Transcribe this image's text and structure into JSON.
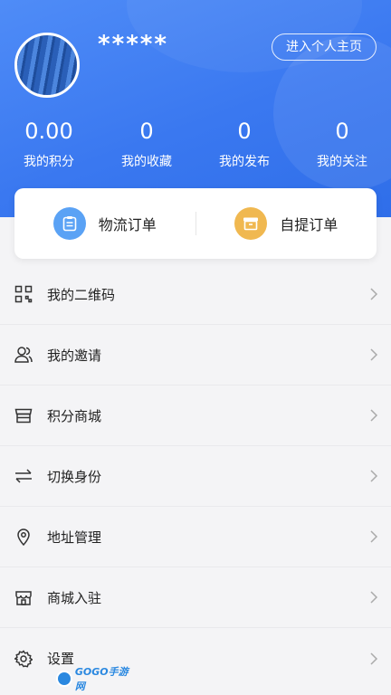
{
  "profile": {
    "username": "*****",
    "home_button": "进入个人主页"
  },
  "stats": [
    {
      "value": "0.00",
      "label": "我的积分"
    },
    {
      "value": "0",
      "label": "我的收藏"
    },
    {
      "value": "0",
      "label": "我的发布"
    },
    {
      "value": "0",
      "label": "我的关注"
    }
  ],
  "orders": [
    {
      "label": "物流订单",
      "icon": "clipboard-icon",
      "color": "#5aa2f5"
    },
    {
      "label": "自提订单",
      "icon": "box-icon",
      "color": "#f0b850"
    }
  ],
  "menu": [
    {
      "label": "我的二维码",
      "icon": "qr-code-icon"
    },
    {
      "label": "我的邀请",
      "icon": "users-icon"
    },
    {
      "label": "积分商城",
      "icon": "store-icon"
    },
    {
      "label": "切换身份",
      "icon": "switch-icon"
    },
    {
      "label": "地址管理",
      "icon": "location-icon"
    },
    {
      "label": "商城入驻",
      "icon": "shop-icon"
    },
    {
      "label": "设置",
      "icon": "gear-icon"
    }
  ],
  "watermark": {
    "text": "GOGO手游网"
  },
  "colors": {
    "header": "#3a78f0",
    "background": "#f4f4f6"
  }
}
